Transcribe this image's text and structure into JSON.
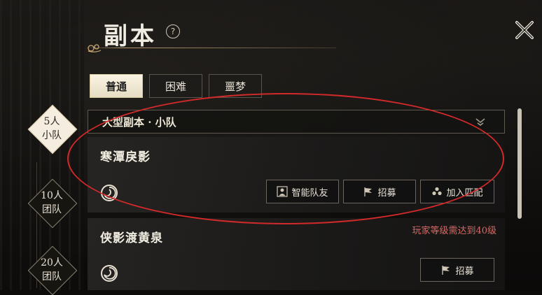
{
  "header": {
    "title": "副本",
    "help_icon": "?"
  },
  "tabs": [
    {
      "label": "普通",
      "active": true
    },
    {
      "label": "困难",
      "active": false
    },
    {
      "label": "噩梦",
      "active": false
    }
  ],
  "levels": [
    {
      "line1": "5人",
      "line2": "小队",
      "active": true
    },
    {
      "line1": "10人",
      "line2": "团队",
      "active": false
    },
    {
      "line1": "20人",
      "line2": "团队",
      "active": false
    }
  ],
  "panel": {
    "header": "大型副本 · 小队"
  },
  "dungeons": [
    {
      "name": "寒潭戾影",
      "requirement": "",
      "buttons": [
        "智能队友",
        "招募",
        "加入匹配"
      ]
    },
    {
      "name": "侠影渡黄泉",
      "requirement": "玩家等级需达到40级",
      "buttons": [
        "招募"
      ]
    }
  ],
  "icons": {
    "close": "close-icon",
    "dropdown": "chevron-down-icon",
    "swirl": "swirl-icon",
    "teammate": "teammate-icon",
    "flag": "flag-icon",
    "match": "match-icon"
  },
  "colors": {
    "annotation": "#d22a2a",
    "requirement_text": "#d46b67",
    "active_tab": "#f4ede0"
  }
}
